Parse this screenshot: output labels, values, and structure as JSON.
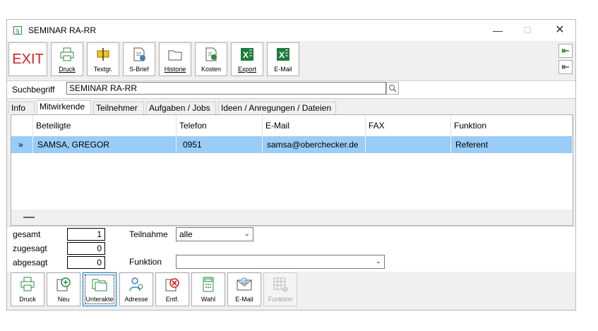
{
  "window": {
    "title": "SEMINAR RA-RR",
    "icon_glyph": "§",
    "minimize": "—",
    "maximize": "☐",
    "close": "✕"
  },
  "toolbar": {
    "exit_label": "EXIT",
    "buttons": [
      {
        "label": "Druck",
        "icon": "printer-icon"
      },
      {
        "label": "Textgr.",
        "icon": "text-block-icon"
      },
      {
        "label": "S-Brief",
        "icon": "letter-gear-icon"
      },
      {
        "label": "Historie",
        "icon": "folder-icon"
      },
      {
        "label": "Kosten",
        "icon": "cost-sheet-icon"
      },
      {
        "label": "Export",
        "icon": "excel-icon"
      },
      {
        "label": "E-Mail",
        "icon": "excel-mail-icon"
      }
    ],
    "side_top": "⇤",
    "side_bottom": "⇤"
  },
  "search": {
    "label": "Suchbegriff",
    "value": "SEMINAR RA-RR"
  },
  "tabs": [
    {
      "label": "Info"
    },
    {
      "label": "Mitwirkende",
      "active": true
    },
    {
      "label": "Teilnehmer"
    },
    {
      "label": "Aufgaben / Jobs"
    },
    {
      "label": "Ideen / Anregungen / Dateien"
    }
  ],
  "grid": {
    "columns": [
      "Beteiligte",
      "Telefon",
      "E-Mail",
      "FAX",
      "Funktion"
    ],
    "rows": [
      {
        "marker": "»",
        "beteiligte": "SAMSA, GREGOR",
        "telefon": "0951",
        "email": "samsa@oberchecker.de",
        "fax": "",
        "funktion": "Referent"
      }
    ]
  },
  "stats": {
    "gesamt_label": "gesamt",
    "gesamt_value": "1",
    "zugesagt_label": "zugesagt",
    "zugesagt_value": "0",
    "abgesagt_label": "abgesagt",
    "abgesagt_value": "0",
    "teilnahme_label": "Teilnahme",
    "teilnahme_value": "alle",
    "funktion_label": "Funktion",
    "funktion_value": ""
  },
  "bottom_toolbar": {
    "buttons": [
      {
        "label": "Druck",
        "icon": "printer-icon"
      },
      {
        "label": "Neu",
        "icon": "add-icon"
      },
      {
        "label": "Unterakte",
        "icon": "subfolder-icon"
      },
      {
        "label": "Adresse",
        "icon": "address-person-icon"
      },
      {
        "label": "Entf.",
        "icon": "delete-icon"
      },
      {
        "label": "Wahl",
        "icon": "phone-dial-icon"
      },
      {
        "label": "E-Mail",
        "icon": "email-envelope-icon"
      },
      {
        "label": "Funktion",
        "icon": "function-grid-icon"
      }
    ]
  },
  "colors": {
    "selected_row": "#99ccf6",
    "exit_red": "#d61f1f",
    "icon_green": "#2e8b3a",
    "excel_green": "#1e7b3c"
  }
}
